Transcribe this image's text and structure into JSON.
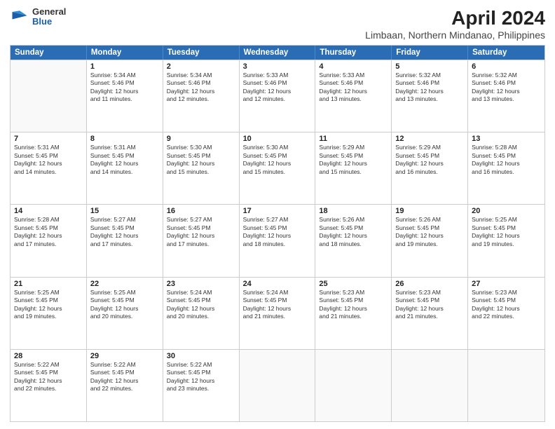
{
  "logo": {
    "general": "General",
    "blue": "Blue"
  },
  "title": "April 2024",
  "subtitle": "Limbaan, Northern Mindanao, Philippines",
  "header_days": [
    "Sunday",
    "Monday",
    "Tuesday",
    "Wednesday",
    "Thursday",
    "Friday",
    "Saturday"
  ],
  "weeks": [
    [
      {
        "day": "",
        "info": ""
      },
      {
        "day": "1",
        "info": "Sunrise: 5:34 AM\nSunset: 5:46 PM\nDaylight: 12 hours\nand 11 minutes."
      },
      {
        "day": "2",
        "info": "Sunrise: 5:34 AM\nSunset: 5:46 PM\nDaylight: 12 hours\nand 12 minutes."
      },
      {
        "day": "3",
        "info": "Sunrise: 5:33 AM\nSunset: 5:46 PM\nDaylight: 12 hours\nand 12 minutes."
      },
      {
        "day": "4",
        "info": "Sunrise: 5:33 AM\nSunset: 5:46 PM\nDaylight: 12 hours\nand 13 minutes."
      },
      {
        "day": "5",
        "info": "Sunrise: 5:32 AM\nSunset: 5:46 PM\nDaylight: 12 hours\nand 13 minutes."
      },
      {
        "day": "6",
        "info": "Sunrise: 5:32 AM\nSunset: 5:46 PM\nDaylight: 12 hours\nand 13 minutes."
      }
    ],
    [
      {
        "day": "7",
        "info": "Sunrise: 5:31 AM\nSunset: 5:45 PM\nDaylight: 12 hours\nand 14 minutes."
      },
      {
        "day": "8",
        "info": "Sunrise: 5:31 AM\nSunset: 5:45 PM\nDaylight: 12 hours\nand 14 minutes."
      },
      {
        "day": "9",
        "info": "Sunrise: 5:30 AM\nSunset: 5:45 PM\nDaylight: 12 hours\nand 15 minutes."
      },
      {
        "day": "10",
        "info": "Sunrise: 5:30 AM\nSunset: 5:45 PM\nDaylight: 12 hours\nand 15 minutes."
      },
      {
        "day": "11",
        "info": "Sunrise: 5:29 AM\nSunset: 5:45 PM\nDaylight: 12 hours\nand 15 minutes."
      },
      {
        "day": "12",
        "info": "Sunrise: 5:29 AM\nSunset: 5:45 PM\nDaylight: 12 hours\nand 16 minutes."
      },
      {
        "day": "13",
        "info": "Sunrise: 5:28 AM\nSunset: 5:45 PM\nDaylight: 12 hours\nand 16 minutes."
      }
    ],
    [
      {
        "day": "14",
        "info": "Sunrise: 5:28 AM\nSunset: 5:45 PM\nDaylight: 12 hours\nand 17 minutes."
      },
      {
        "day": "15",
        "info": "Sunrise: 5:27 AM\nSunset: 5:45 PM\nDaylight: 12 hours\nand 17 minutes."
      },
      {
        "day": "16",
        "info": "Sunrise: 5:27 AM\nSunset: 5:45 PM\nDaylight: 12 hours\nand 17 minutes."
      },
      {
        "day": "17",
        "info": "Sunrise: 5:27 AM\nSunset: 5:45 PM\nDaylight: 12 hours\nand 18 minutes."
      },
      {
        "day": "18",
        "info": "Sunrise: 5:26 AM\nSunset: 5:45 PM\nDaylight: 12 hours\nand 18 minutes."
      },
      {
        "day": "19",
        "info": "Sunrise: 5:26 AM\nSunset: 5:45 PM\nDaylight: 12 hours\nand 19 minutes."
      },
      {
        "day": "20",
        "info": "Sunrise: 5:25 AM\nSunset: 5:45 PM\nDaylight: 12 hours\nand 19 minutes."
      }
    ],
    [
      {
        "day": "21",
        "info": "Sunrise: 5:25 AM\nSunset: 5:45 PM\nDaylight: 12 hours\nand 19 minutes."
      },
      {
        "day": "22",
        "info": "Sunrise: 5:25 AM\nSunset: 5:45 PM\nDaylight: 12 hours\nand 20 minutes."
      },
      {
        "day": "23",
        "info": "Sunrise: 5:24 AM\nSunset: 5:45 PM\nDaylight: 12 hours\nand 20 minutes."
      },
      {
        "day": "24",
        "info": "Sunrise: 5:24 AM\nSunset: 5:45 PM\nDaylight: 12 hours\nand 21 minutes."
      },
      {
        "day": "25",
        "info": "Sunrise: 5:23 AM\nSunset: 5:45 PM\nDaylight: 12 hours\nand 21 minutes."
      },
      {
        "day": "26",
        "info": "Sunrise: 5:23 AM\nSunset: 5:45 PM\nDaylight: 12 hours\nand 21 minutes."
      },
      {
        "day": "27",
        "info": "Sunrise: 5:23 AM\nSunset: 5:45 PM\nDaylight: 12 hours\nand 22 minutes."
      }
    ],
    [
      {
        "day": "28",
        "info": "Sunrise: 5:22 AM\nSunset: 5:45 PM\nDaylight: 12 hours\nand 22 minutes."
      },
      {
        "day": "29",
        "info": "Sunrise: 5:22 AM\nSunset: 5:45 PM\nDaylight: 12 hours\nand 22 minutes."
      },
      {
        "day": "30",
        "info": "Sunrise: 5:22 AM\nSunset: 5:45 PM\nDaylight: 12 hours\nand 23 minutes."
      },
      {
        "day": "",
        "info": ""
      },
      {
        "day": "",
        "info": ""
      },
      {
        "day": "",
        "info": ""
      },
      {
        "day": "",
        "info": ""
      }
    ]
  ]
}
